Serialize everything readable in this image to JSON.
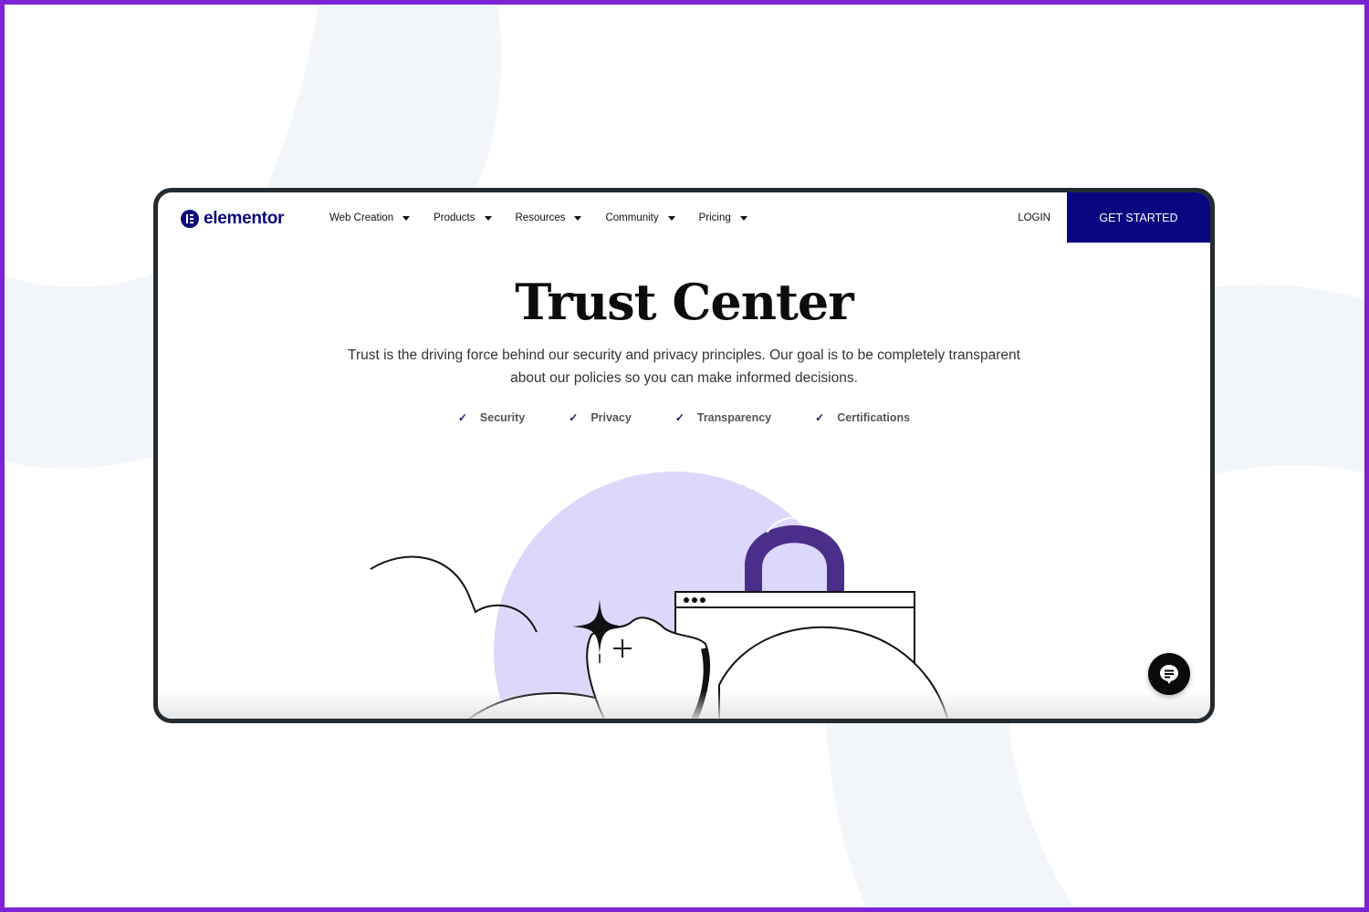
{
  "colors": {
    "frame_border": "#7b22d4",
    "brand": "#0d0a7a",
    "cta_bg": "#07057f",
    "lock_purple": "#4b2e8a",
    "circle_lavender": "#dcd8fb",
    "bg_arc": "#f2f5f9"
  },
  "nav": {
    "logo_text": "elementor",
    "menu": [
      {
        "label": "Web Creation"
      },
      {
        "label": "Products"
      },
      {
        "label": "Resources"
      },
      {
        "label": "Community"
      },
      {
        "label": "Pricing"
      }
    ],
    "login_label": "LOGIN",
    "cta_label": "GET STARTED"
  },
  "hero": {
    "title": "Trust Center",
    "subtitle": "Trust is the driving force behind our security and privacy principles. Our goal is to be completely transparent about our policies so you can make informed decisions.",
    "features": [
      {
        "icon": "check-icon",
        "label": "Security"
      },
      {
        "icon": "check-icon",
        "label": "Privacy"
      },
      {
        "icon": "check-icon",
        "label": "Transparency"
      },
      {
        "icon": "check-icon",
        "label": "Certifications"
      }
    ],
    "check_glyph": "✓"
  },
  "chat": {
    "icon": "chat-bubble-icon"
  }
}
